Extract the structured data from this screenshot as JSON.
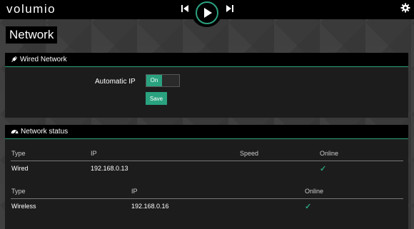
{
  "app": {
    "logo_text": "volumio"
  },
  "colors": {
    "accent": "#2aa27f",
    "background": "#3a3a3a",
    "bar": "#000000"
  },
  "topbar": {
    "prev_icon": "skip-back-icon",
    "play_icon": "play-icon",
    "next_icon": "skip-forward-icon",
    "settings_icon": "gear-icon"
  },
  "page": {
    "title": "Network"
  },
  "wired": {
    "header": "Wired Network",
    "icon": "plug-icon",
    "automatic_ip_label": "Automatic IP",
    "toggle_label": "On",
    "toggle_state": true,
    "save_label": "Save"
  },
  "status": {
    "header": "Network status",
    "icon": "dashboard-icon",
    "wired_table": {
      "columns": [
        "Type",
        "IP",
        "Speed",
        "Online"
      ],
      "row": {
        "type": "Wired",
        "ip": "192.168.0.13",
        "speed": "",
        "online": "✓"
      }
    },
    "wireless_table": {
      "columns": [
        "Type",
        "IP",
        "Online"
      ],
      "row": {
        "type": "Wireless",
        "ip": "192.168.0.16",
        "online": "✓"
      }
    }
  }
}
